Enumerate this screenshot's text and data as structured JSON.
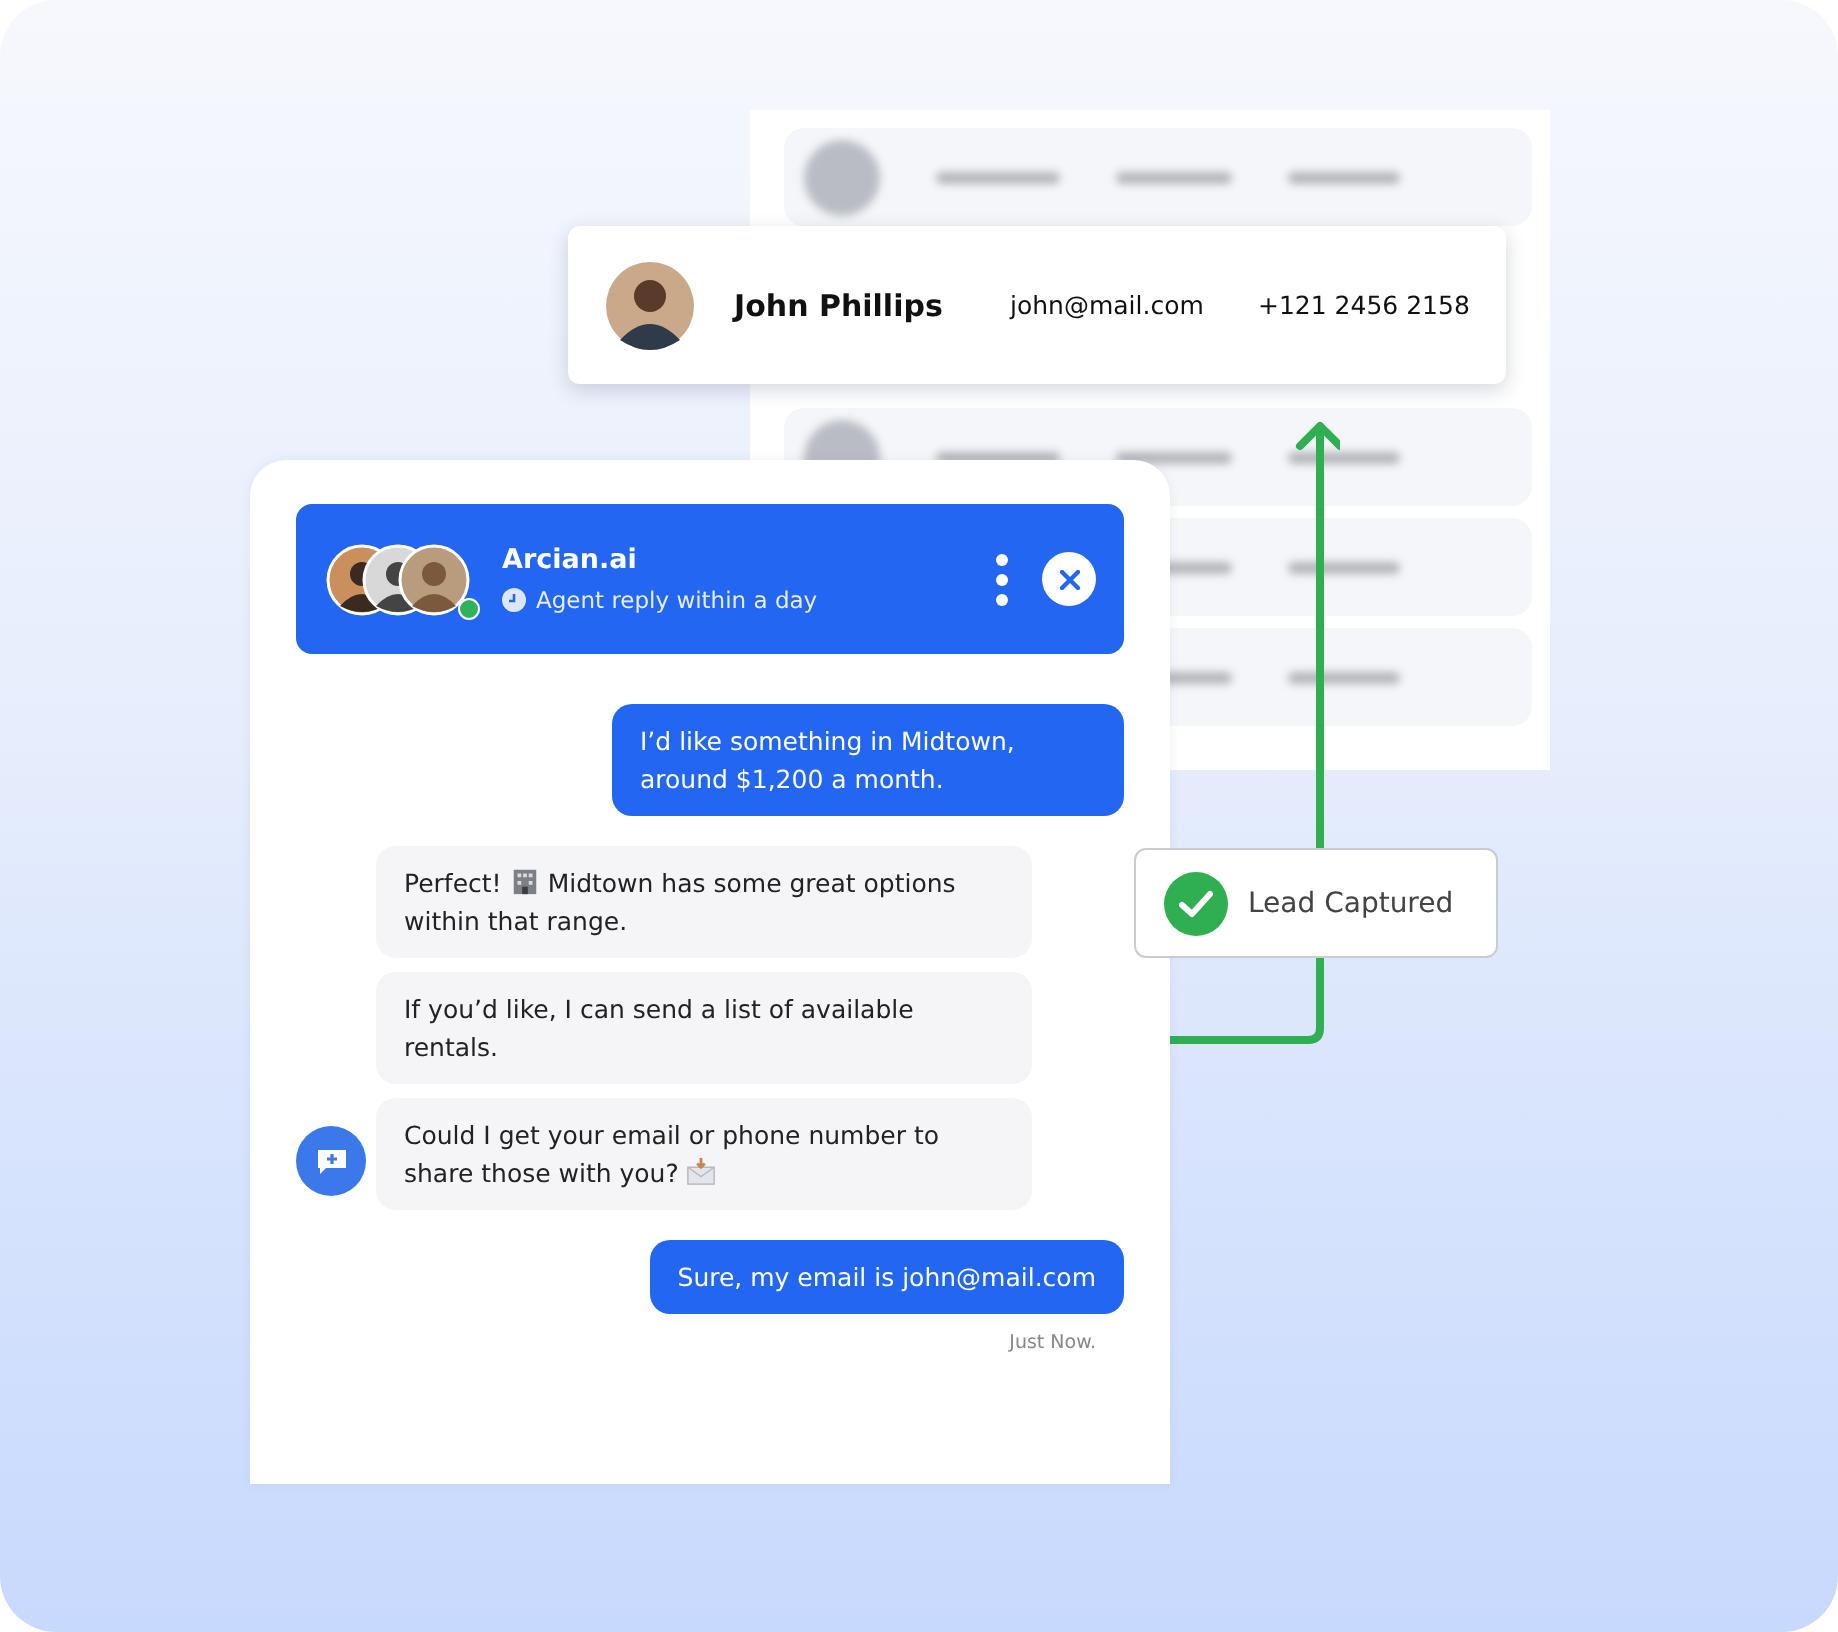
{
  "lead_table": {
    "rows": [
      {
        "kind": "blurred"
      },
      {
        "kind": "contact",
        "name": "John Phillips",
        "email": "john@mail.com",
        "phone": "+121 2456 2158"
      },
      {
        "kind": "blurred"
      },
      {
        "kind": "blurred"
      },
      {
        "kind": "blurred"
      }
    ]
  },
  "lead_badge": {
    "label": "Lead Captured",
    "checked": true
  },
  "chat": {
    "header": {
      "title": "Arcian.ai",
      "subtitle": "Agent reply within a day",
      "online": true
    },
    "messages": [
      {
        "kind": "sent",
        "parts": [
          {
            "kind": "text",
            "text": "I’d like something in Midtown, around $1,200 a month."
          }
        ]
      },
      {
        "kind": "received",
        "avatar": false,
        "parts": [
          {
            "kind": "text",
            "text": "Perfect!"
          },
          {
            "kind": "building"
          },
          {
            "kind": "text",
            "text": "Midtown has some great options within that range."
          }
        ]
      },
      {
        "kind": "received",
        "avatar": false,
        "parts": [
          {
            "kind": "text",
            "text": "If you’d like, I can send a list of available rentals."
          }
        ]
      },
      {
        "kind": "received",
        "avatar": true,
        "parts": [
          {
            "kind": "text",
            "text": "Could I get your email or phone number to share those with you?"
          },
          {
            "kind": "envelope"
          }
        ]
      },
      {
        "kind": "sent",
        "time": "Just Now.",
        "parts": [
          {
            "kind": "text",
            "text": "Sure, my email is john@mail.com"
          }
        ]
      }
    ]
  }
}
